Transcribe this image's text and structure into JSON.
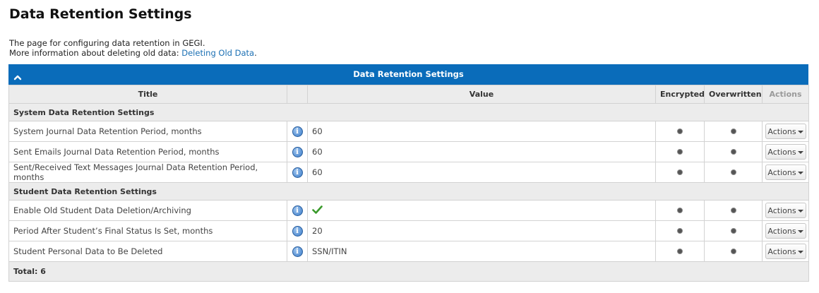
{
  "page": {
    "title": "Data Retention Settings",
    "intro_line1": "The page for configuring data retention in GEGI.",
    "intro_line2_prefix": "More information about deleting old data: ",
    "intro_link": "Deleting Old Data",
    "intro_line2_suffix": "."
  },
  "panel": {
    "title": "Data Retention Settings",
    "toggle_icon": "chevron-up-icon",
    "accent_color": "#0a6cba"
  },
  "table": {
    "columns": {
      "title": "Title",
      "info": "",
      "value": "Value",
      "encrypted": "Encrypted",
      "overwritten": "Overwritten",
      "actions": "Actions"
    },
    "sections": [
      {
        "label": "System Data Retention Settings",
        "rows": [
          {
            "title": "System Journal Data Retention Period, months",
            "value": "60",
            "value_icon": "",
            "action_label": "Actions"
          },
          {
            "title": "Sent Emails Journal Data Retention Period, months",
            "value": "60",
            "value_icon": "",
            "action_label": "Actions"
          },
          {
            "title": "Sent/Received Text Messages Journal Data Retention Period, months",
            "value": "60",
            "value_icon": "",
            "action_label": "Actions"
          }
        ]
      },
      {
        "label": "Student Data Retention Settings",
        "rows": [
          {
            "title": "Enable Old Student Data Deletion/Archiving",
            "value": "",
            "value_icon": "checkmark-icon",
            "action_label": "Actions"
          },
          {
            "title": "Period After Student’s Final Status Is Set, months",
            "value": "20",
            "value_icon": "",
            "action_label": "Actions"
          },
          {
            "title": "Student Personal Data to Be Deleted",
            "value": "SSN/ITIN",
            "value_icon": "",
            "action_label": "Actions"
          }
        ]
      }
    ],
    "footer": "Total: 6"
  }
}
